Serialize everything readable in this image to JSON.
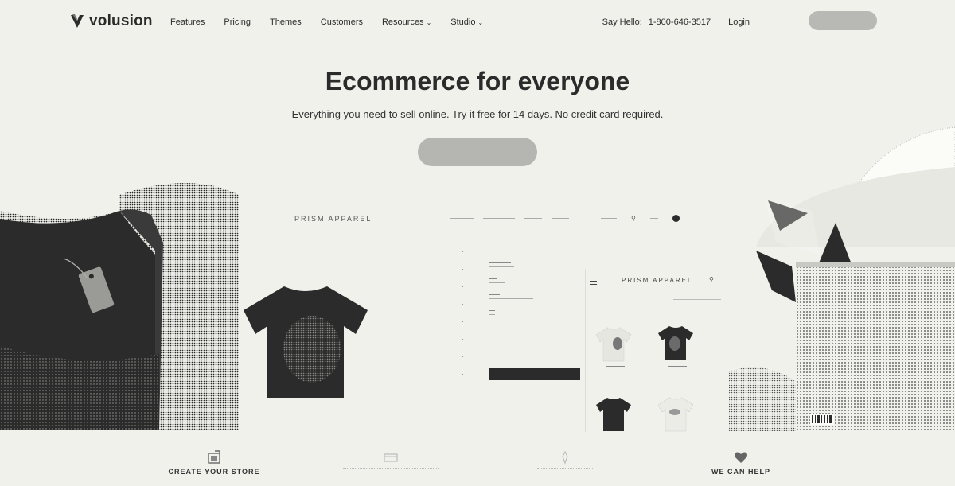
{
  "brand": {
    "name": "volusion",
    "logo_icon": "volusion-v-logo-icon"
  },
  "nav": {
    "links": [
      {
        "label": "Features",
        "caret": false
      },
      {
        "label": "Pricing",
        "caret": false
      },
      {
        "label": "Themes",
        "caret": false
      },
      {
        "label": "Customers",
        "caret": false
      },
      {
        "label": "Resources",
        "caret": true
      },
      {
        "label": "Studio",
        "caret": true
      }
    ],
    "say_hello": "Say Hello:",
    "phone": "1-800-646-3517",
    "login": "Login",
    "cta_label": ""
  },
  "hero": {
    "title": "Ecommerce for everyone",
    "subtitle": "Everything you need to sell online. Try it free for 14 days. No credit card required.",
    "cta_label": ""
  },
  "store_demo": {
    "brand": "PRISM APPAREL",
    "nav": [
      "",
      "",
      "",
      ""
    ],
    "search_label": "",
    "cart_label": "",
    "product": {
      "name": "",
      "add_to_cart": "",
      "wishlist": ""
    },
    "mobile": {
      "brand": "PRISM APPAREL",
      "heading": ""
    }
  },
  "features": [
    {
      "label": "CREATE YOUR STORE",
      "icon": "store-icon"
    },
    {
      "label": "",
      "icon": "browser-icon"
    },
    {
      "label": "",
      "icon": "rocket-icon"
    },
    {
      "label": "WE CAN HELP",
      "icon": "heart-icon"
    }
  ],
  "colors": {
    "background": "#f1f1ec",
    "ink": "#2b2b2b",
    "button_grey": "#b5b5b1"
  }
}
